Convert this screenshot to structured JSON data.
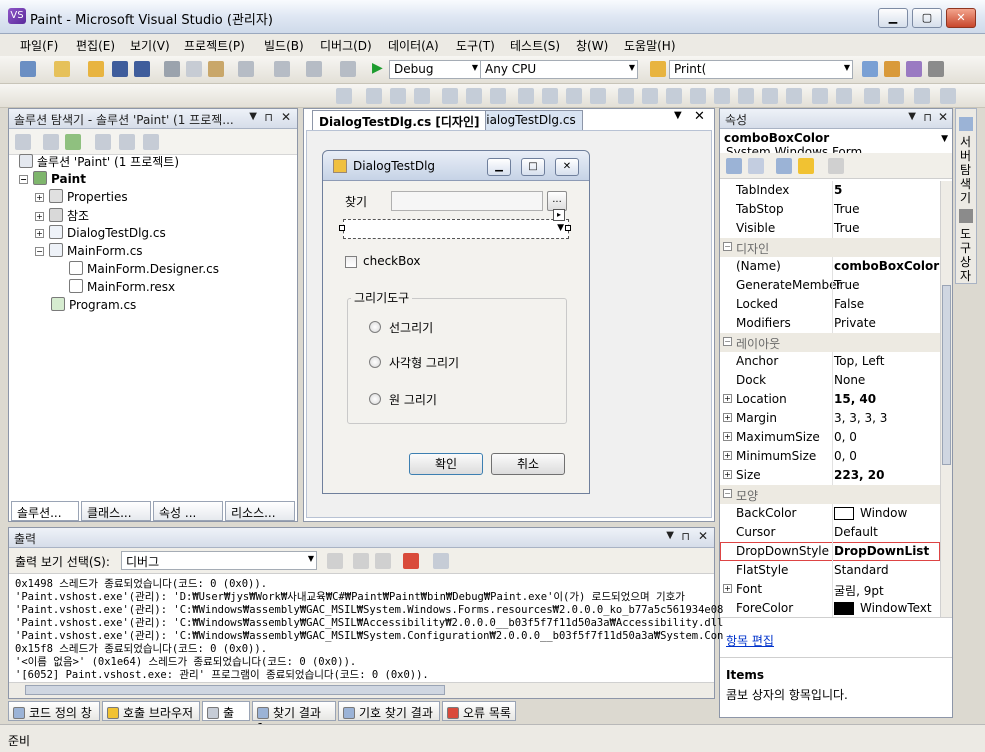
{
  "window": {
    "title": "Paint - Microsoft Visual Studio (관리자)"
  },
  "menu": [
    "파일(F)",
    "편집(E)",
    "보기(V)",
    "프로젝트(P)",
    "빌드(B)",
    "디버그(D)",
    "데이터(A)",
    "도구(T)",
    "테스트(S)",
    "창(W)",
    "도움말(H)"
  ],
  "toolbar": {
    "config": "Debug",
    "platform": "Any CPU",
    "find": "Print("
  },
  "solution_explorer": {
    "title": "솔루션 탐색기 - 솔루션 'Paint' (1 프로젝...",
    "items": [
      "솔루션 'Paint' (1 프로젝트)",
      "Paint",
      "Properties",
      "참조",
      "DialogTestDlg.cs",
      "MainForm.cs",
      "MainForm.Designer.cs",
      "MainForm.resx",
      "Program.cs"
    ],
    "tabs": [
      "솔루션...",
      "클래스...",
      "속성 ...",
      "리소스..."
    ]
  },
  "doc_tabs": [
    "DialogTestDlg.cs [디자인]",
    "DialogTestDlg.cs"
  ],
  "designer": {
    "form_title": "DialogTestDlg",
    "find_label": "찾기",
    "browse": "...",
    "checkbox": "checkBox",
    "group": "그리기도구",
    "radios": [
      "선그리기",
      "사각형 그리기",
      "원 그리기"
    ],
    "ok": "확인",
    "cancel": "취소"
  },
  "properties": {
    "title": "속성",
    "object": "comboBoxColor",
    "object_type": "System.Windows.Form",
    "rows": [
      {
        "n": "TabIndex",
        "v": "5",
        "bold": true
      },
      {
        "n": "TabStop",
        "v": "True"
      },
      {
        "n": "Visible",
        "v": "True"
      },
      {
        "cat": "디자인"
      },
      {
        "n": "(Name)",
        "v": "comboBoxColor",
        "bold": true
      },
      {
        "n": "GenerateMember",
        "v": "True"
      },
      {
        "n": "Locked",
        "v": "False"
      },
      {
        "n": "Modifiers",
        "v": "Private"
      },
      {
        "cat": "레이아웃"
      },
      {
        "n": "Anchor",
        "v": "Top, Left"
      },
      {
        "n": "Dock",
        "v": "None"
      },
      {
        "n": "Location",
        "v": "15, 40",
        "bold": true,
        "exp": true
      },
      {
        "n": "Margin",
        "v": "3, 3, 3, 3",
        "exp": true
      },
      {
        "n": "MaximumSize",
        "v": "0, 0",
        "exp": true
      },
      {
        "n": "MinimumSize",
        "v": "0, 0",
        "exp": true
      },
      {
        "n": "Size",
        "v": "223, 20",
        "bold": true,
        "exp": true
      },
      {
        "cat": "모양"
      },
      {
        "n": "BackColor",
        "v": "Window",
        "swatch": "#ffffff"
      },
      {
        "n": "Cursor",
        "v": "Default"
      },
      {
        "n": "DropDownStyle",
        "v": "DropDownList",
        "bold": true,
        "highlight": true
      },
      {
        "n": "FlatStyle",
        "v": "Standard"
      },
      {
        "n": "Font",
        "v": "굴림, 9pt",
        "exp": true
      },
      {
        "n": "ForeColor",
        "v": "WindowText",
        "swatch": "#000000"
      }
    ],
    "edit_link": "항목 편집",
    "desc_title": "Items",
    "desc_text": "콤보 상자의 항목입니다."
  },
  "right_strip": [
    "서버 탐색기",
    "도구 상자"
  ],
  "output": {
    "title": "출력",
    "select_label": "출력 보기 선택(S):",
    "select_value": "디버그",
    "lines": [
      "0x1498 스레드가 종료되었습니다(코드: 0 (0x0)).",
      "'Paint.vshost.exe'(관리): 'D:₩User₩jys₩Work₩사내교육₩C#₩Paint₩Paint₩bin₩Debug₩Paint.exe'이(가) 로드되었으며 기호가",
      "'Paint.vshost.exe'(관리): 'C:₩Windows₩assembly₩GAC_MSIL₩System.Windows.Forms.resources₩2.0.0.0_ko_b77a5c561934e08",
      "'Paint.vshost.exe'(관리): 'C:₩Windows₩assembly₩GAC_MSIL₩Accessibility₩2.0.0.0__b03f5f7f11d50a3a₩Accessibility.dll",
      "'Paint.vshost.exe'(관리): 'C:₩Windows₩assembly₩GAC_MSIL₩System.Configuration₩2.0.0.0__b03f5f7f11d50a3a₩System.Con",
      "0x15f8 스레드가 종료되었습니다(코드: 0 (0x0)).",
      "'<이름 없음>' (0x1e64) 스레드가 종료되었습니다(코드: 0 (0x0)).",
      "'[6052] Paint.vshost.exe: 관리' 프로그램이 종료되었습니다(코드: 0 (0x0))."
    ]
  },
  "bottom_tabs": [
    "코드 정의 창",
    "호출 브라우저",
    "출력",
    "찾기 결과 1",
    "기호 찾기 결과",
    "오류 목록"
  ],
  "status": "준비"
}
